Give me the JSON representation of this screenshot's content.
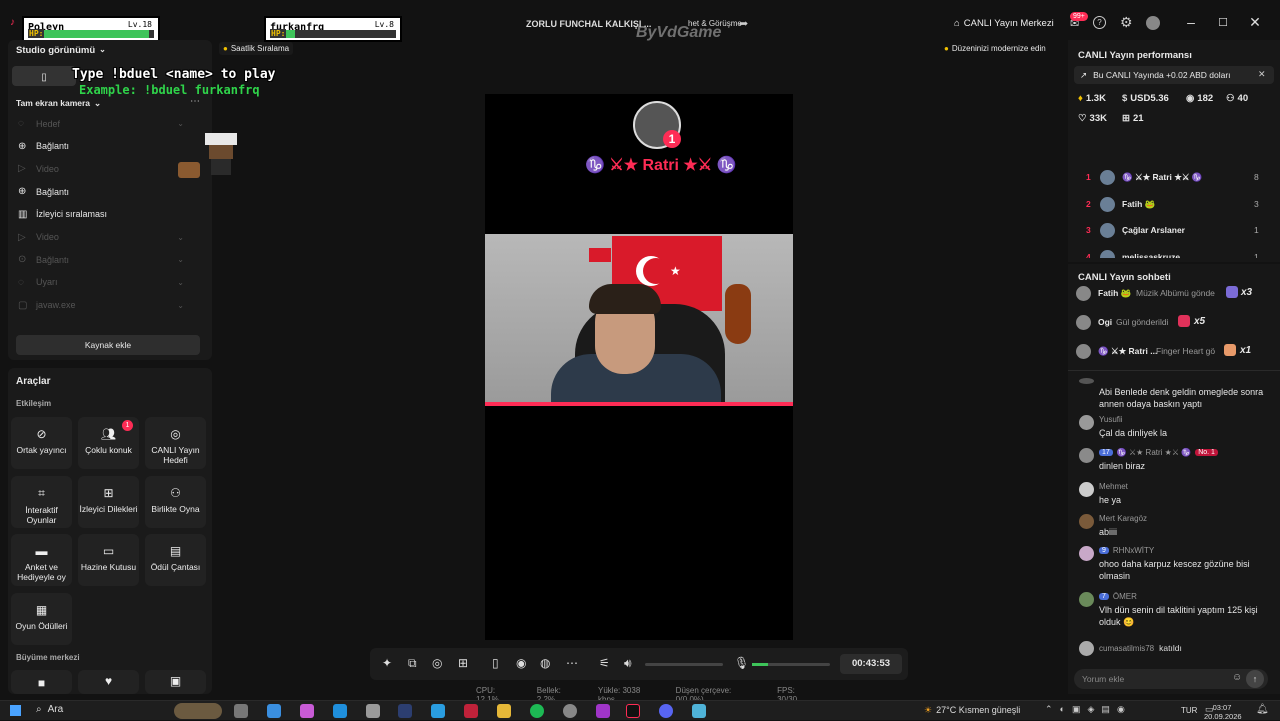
{
  "title": {
    "left_text": "ZORLU FUNCHAL KALKIŞI ...",
    "right_text": "het & Görüşme",
    "watermark": "ByVdGame",
    "live_center": "CANLI Yayın Merkezi",
    "notif_badge": "99+"
  },
  "game": {
    "player1": {
      "name": "Poleyn",
      "level": "Lv.18",
      "hp": 0.95
    },
    "player2": {
      "name": "furkanfrq",
      "level": "Lv.8",
      "hp": 0.08
    },
    "hp_label": "HP:",
    "prompt_line1": "Type !bduel <name> to play",
    "prompt_line2": "Example: !bduel furkanfrq"
  },
  "studio": {
    "view_label": "Studio görünümü",
    "hourly_rank": "Saatlik Sıralama",
    "modernize": "Düzeninizi modernize edin",
    "scene_label": "Tam ekran kamera",
    "sources": [
      {
        "label": "Hedef",
        "dim": true
      },
      {
        "label": "Bağlantı",
        "dim": false
      },
      {
        "label": "Video",
        "dim": true
      },
      {
        "label": "Bağlantı",
        "dim": false
      },
      {
        "label": "İzleyici sıralaması",
        "dim": false
      },
      {
        "label": "Video",
        "dim": true
      },
      {
        "label": "Bağlantı",
        "dim": true
      },
      {
        "label": "Uyarı",
        "dim": true
      },
      {
        "label": "javaw.exe",
        "dim": true
      }
    ],
    "add_source": "Kaynak ekle"
  },
  "tools": {
    "title": "Araçlar",
    "section1": "Etkileşim",
    "items": [
      {
        "label": "Ortak yayıncı",
        "icon": "link-icon"
      },
      {
        "label": "Çoklu konuk",
        "icon": "users-icon",
        "badge": "1"
      },
      {
        "label": "CANLI Yayın Hedefi",
        "icon": "target-icon"
      },
      {
        "label": "İnteraktif Oyunlar",
        "icon": "gamepad-icon"
      },
      {
        "label": "İzleyici Dilekleri",
        "icon": "gift-icon"
      },
      {
        "label": "Birlikte Oyna",
        "icon": "play-together-icon"
      },
      {
        "label": "Anket ve Hediyeyle oy",
        "icon": "poll-icon"
      },
      {
        "label": "Hazine Kutusu",
        "icon": "treasure-icon"
      },
      {
        "label": "Ödül Çantası",
        "icon": "bag-icon"
      },
      {
        "label": "Oyun Ödülleri",
        "icon": "trophy-icon"
      }
    ],
    "section2": "Büyüme merkezi"
  },
  "stage": {
    "top_user": "♑ ⚔★ Ratri ★⚔ ♑",
    "rank_badge": "1"
  },
  "controls": {
    "timer": "00:43:53",
    "volume": 0.0,
    "mic": 0.2
  },
  "status": {
    "cpu": "CPU: 12.1%",
    "memory": "Bellek: 2.2%",
    "upload": "Yükle: 3038 kbps",
    "dropped": "Düşen çerçeve: 0(0.0%)",
    "fps": "FPS: 30/30"
  },
  "performance": {
    "title": "CANLI Yayın performansı",
    "banner": "Bu CANLI Yayında +0.02 ABD doları",
    "stats": [
      {
        "icon": "diamond-icon",
        "value": "1.3K"
      },
      {
        "icon": "coin-icon",
        "value": "USD5.36"
      },
      {
        "icon": "viewers-icon",
        "value": "182"
      },
      {
        "icon": "new-followers-icon",
        "value": "40"
      },
      {
        "icon": "heart-icon",
        "value": "33K"
      },
      {
        "icon": "gift-icon",
        "value": "21"
      }
    ],
    "ranking": [
      {
        "rank": "1",
        "name": "♑ ⚔★ Ratri ★⚔ ♑",
        "count": "8"
      },
      {
        "rank": "2",
        "name": "Fatih 🐸",
        "count": "3"
      },
      {
        "rank": "3",
        "name": "Çağlar Arslaner",
        "count": "1"
      },
      {
        "rank": "4",
        "name": "melissaskruze",
        "count": "1"
      }
    ]
  },
  "chat": {
    "title": "CANLI Yayın sohbeti",
    "gifts": [
      {
        "user": "Fatih 🐸",
        "text": "Müzik Albümü gönde",
        "mult": "x3"
      },
      {
        "user": "Ogi",
        "text": "Gül gönderildi",
        "mult": "x5"
      },
      {
        "user": "♑ ⚔★ Ratri ...",
        "text": "Finger Heart gö",
        "mult": "x1"
      }
    ],
    "messages": [
      {
        "user": "",
        "text": "Abi Benlede denk geldin omeglede sonra annen odaya baskın yaptı"
      },
      {
        "user": "Yusufii",
        "text": "Çal da dinliyek la"
      },
      {
        "user": "♑ ⚔★ Ratri ★⚔ ♑",
        "badges": "17",
        "extra": "No. 1",
        "text": "dinlen biraz"
      },
      {
        "user": "Mehmet",
        "text": "he ya"
      },
      {
        "user": "Mert Karagöz",
        "text": "abiiii"
      },
      {
        "user": "RHNxWİTY",
        "badges": "9",
        "text": "ohoo daha karpuz kescez gözüne bisi olmasin"
      },
      {
        "user": "ÖMER",
        "badges": "7",
        "text": "Vlh dün senin dil taklitini yaptım 125 kişi olduk 😊"
      },
      {
        "user": "cumasatilmis78",
        "text": "katıldı"
      }
    ],
    "input_placeholder": "Yorum ekle"
  },
  "taskbar": {
    "search": "Ara",
    "weather": "27°C  Kısmen güneşli",
    "lang": "TUR",
    "time": "03:07",
    "date": "20.09.2026"
  },
  "colors": {
    "accent": "#fe2c55",
    "panel": "#1a1a1a",
    "hp_green": "#3ec45a",
    "prompt_green": "#2fd34a"
  }
}
